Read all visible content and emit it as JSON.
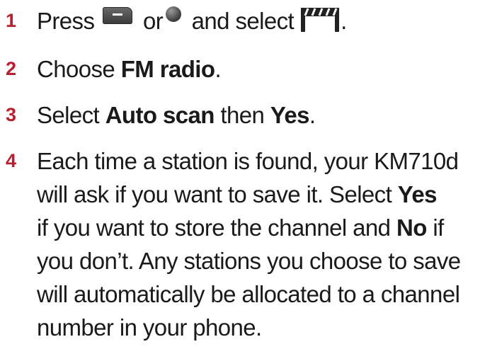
{
  "steps": [
    {
      "number": "1",
      "press": "Press",
      "or": "or",
      "and_select": "and select",
      "period": ".",
      "icons": [
        "menu-key-icon",
        "ok-key-icon",
        "clapper-icon"
      ]
    },
    {
      "number": "2",
      "prefix": "Choose",
      "bold": "FM radio",
      "suffix": "."
    },
    {
      "number": "3",
      "prefix": "Select",
      "bold1": "Auto scan",
      "middle": "then",
      "bold2": "Yes",
      "suffix": "."
    },
    {
      "number": "4",
      "line1": "Each time a station is found, your KM710d",
      "line2_pre": "will ask if you want to save it. Select",
      "line2_bold": "Yes",
      "line3_pre": "if you want to store the channel and",
      "line3_bold": "No",
      "line3_post": "if",
      "line4": "you don’t. Any stations you choose to save",
      "line5": "will automatically be allocated to a channel",
      "line6": "number in your phone."
    }
  ],
  "colors": {
    "step_number": "#b8202f",
    "text": "#1a1a1a"
  }
}
